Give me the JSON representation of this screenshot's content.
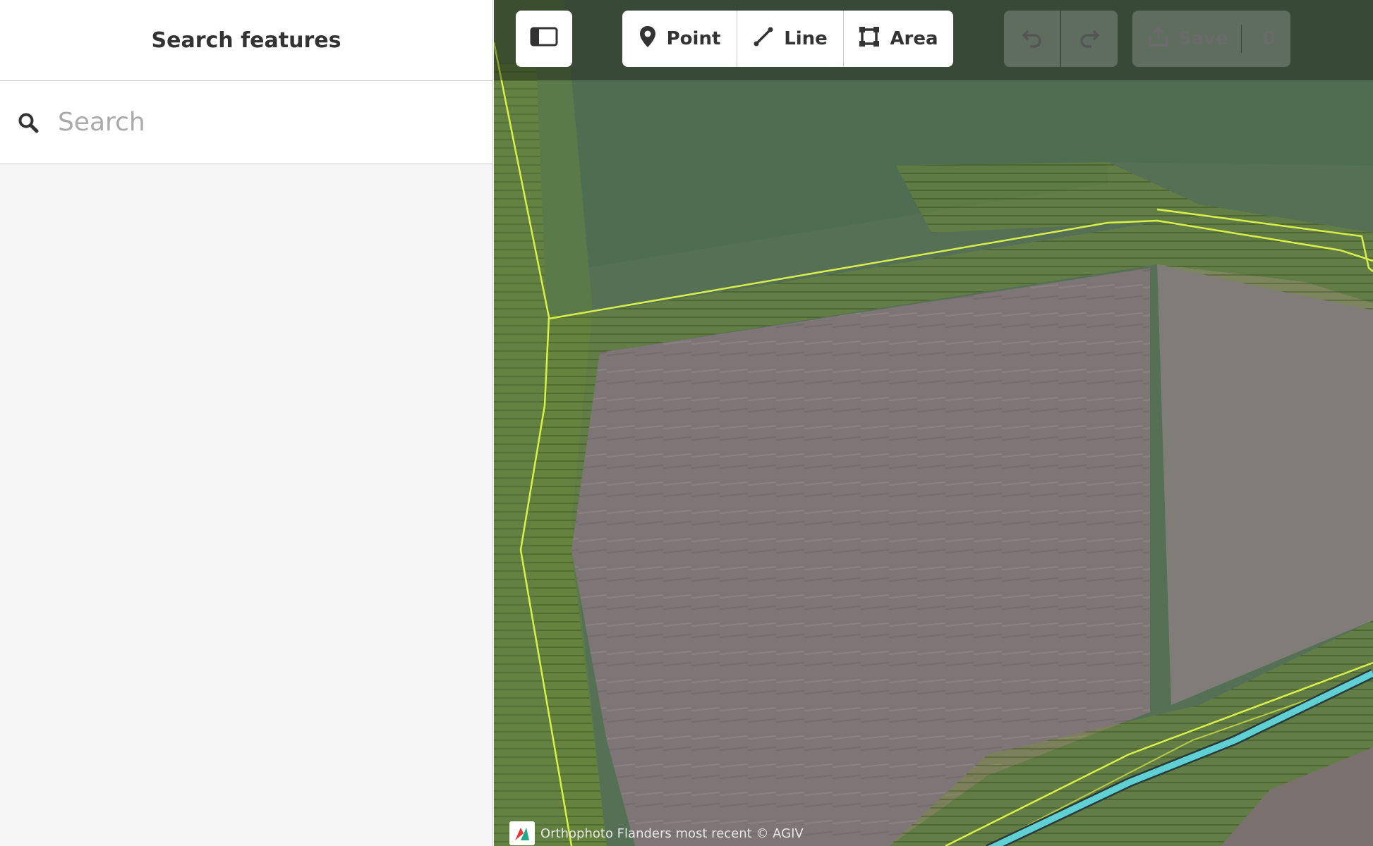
{
  "sidebar": {
    "title": "Search features",
    "search": {
      "placeholder": "Search",
      "value": ""
    }
  },
  "toolbar": {
    "point_label": "Point",
    "line_label": "Line",
    "area_label": "Area",
    "save_label": "Save",
    "save_count": "0"
  },
  "map": {
    "attribution": "Orthophoto Flanders most recent © AGIV"
  },
  "colors": {
    "accent_outline": "#d8f04a",
    "waterway": "#5fd0d4"
  },
  "icons": [
    "search-icon",
    "sidebar-toggle-icon",
    "point-icon",
    "line-icon",
    "area-icon",
    "undo-icon",
    "redo-icon",
    "upload-icon"
  ]
}
